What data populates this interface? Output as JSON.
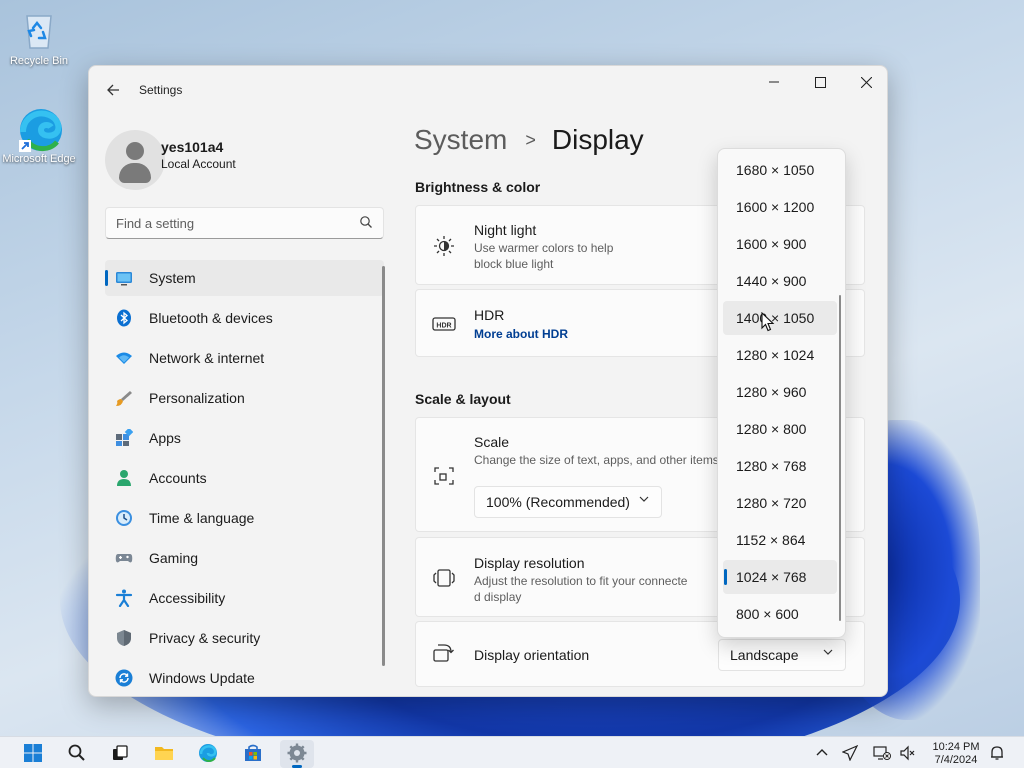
{
  "desktop": {
    "icons": [
      {
        "label": "Recycle Bin",
        "icon": "recycle-bin-icon"
      },
      {
        "label": "Microsoft Edge",
        "icon": "edge-icon"
      }
    ]
  },
  "window": {
    "app_title": "Settings",
    "controls": [
      "minimize",
      "maximize",
      "close"
    ]
  },
  "profile": {
    "name": "yes101a4",
    "account_type": "Local Account"
  },
  "search": {
    "placeholder": "Find a setting"
  },
  "sidebar": {
    "items": [
      {
        "label": "System",
        "icon": "system-icon",
        "selected": true
      },
      {
        "label": "Bluetooth & devices",
        "icon": "bluetooth-icon"
      },
      {
        "label": "Network & internet",
        "icon": "network-icon"
      },
      {
        "label": "Personalization",
        "icon": "brush-icon"
      },
      {
        "label": "Apps",
        "icon": "apps-icon"
      },
      {
        "label": "Accounts",
        "icon": "accounts-icon"
      },
      {
        "label": "Time & language",
        "icon": "time-language-icon"
      },
      {
        "label": "Gaming",
        "icon": "gaming-icon"
      },
      {
        "label": "Accessibility",
        "icon": "accessibility-icon"
      },
      {
        "label": "Privacy & security",
        "icon": "shield-icon"
      },
      {
        "label": "Windows Update",
        "icon": "windows-update-icon"
      }
    ]
  },
  "breadcrumb": {
    "parent": "System",
    "separator": ">",
    "current": "Display"
  },
  "sections": {
    "brightness_color": "Brightness & color",
    "scale_layout": "Scale & layout"
  },
  "cards": {
    "night_light": {
      "title": "Night light",
      "subtitle_line1": "Use warmer colors to help",
      "subtitle_line2": "block blue light"
    },
    "hdr": {
      "title": "HDR",
      "link": "More about HDR",
      "icon_text": "HDR"
    },
    "scale": {
      "title": "Scale",
      "subtitle": "Change the size of text, apps, and other items",
      "value": "100% (Recommended)"
    },
    "display_resolution": {
      "title": "Display resolution",
      "subtitle_line1": "Adjust the resolution to fit your connecte",
      "subtitle_line2": "d display"
    },
    "display_orientation": {
      "title": "Display orientation",
      "value": "Landscape"
    }
  },
  "resolution_dropdown": {
    "options": [
      "1680 × 1050",
      "1600 × 1200",
      "1600 × 900",
      "1440 × 900",
      "1400 × 1050",
      "1280 × 1024",
      "1280 × 960",
      "1280 × 800",
      "1280 × 768",
      "1280 × 720",
      "1152 × 864",
      "1024 × 768",
      "800 × 600"
    ],
    "hovered": "1400 × 1050",
    "selected": "1024 × 768"
  },
  "taskbar": {
    "apps": [
      "start-icon",
      "search-icon",
      "task-view-icon",
      "file-explorer-icon",
      "edge-icon",
      "store-icon",
      "settings-icon"
    ],
    "active_app": "settings-icon",
    "time": "10:24 PM",
    "date": "7/4/2024"
  },
  "colors": {
    "accent": "#0067c0",
    "link": "#003e92"
  }
}
